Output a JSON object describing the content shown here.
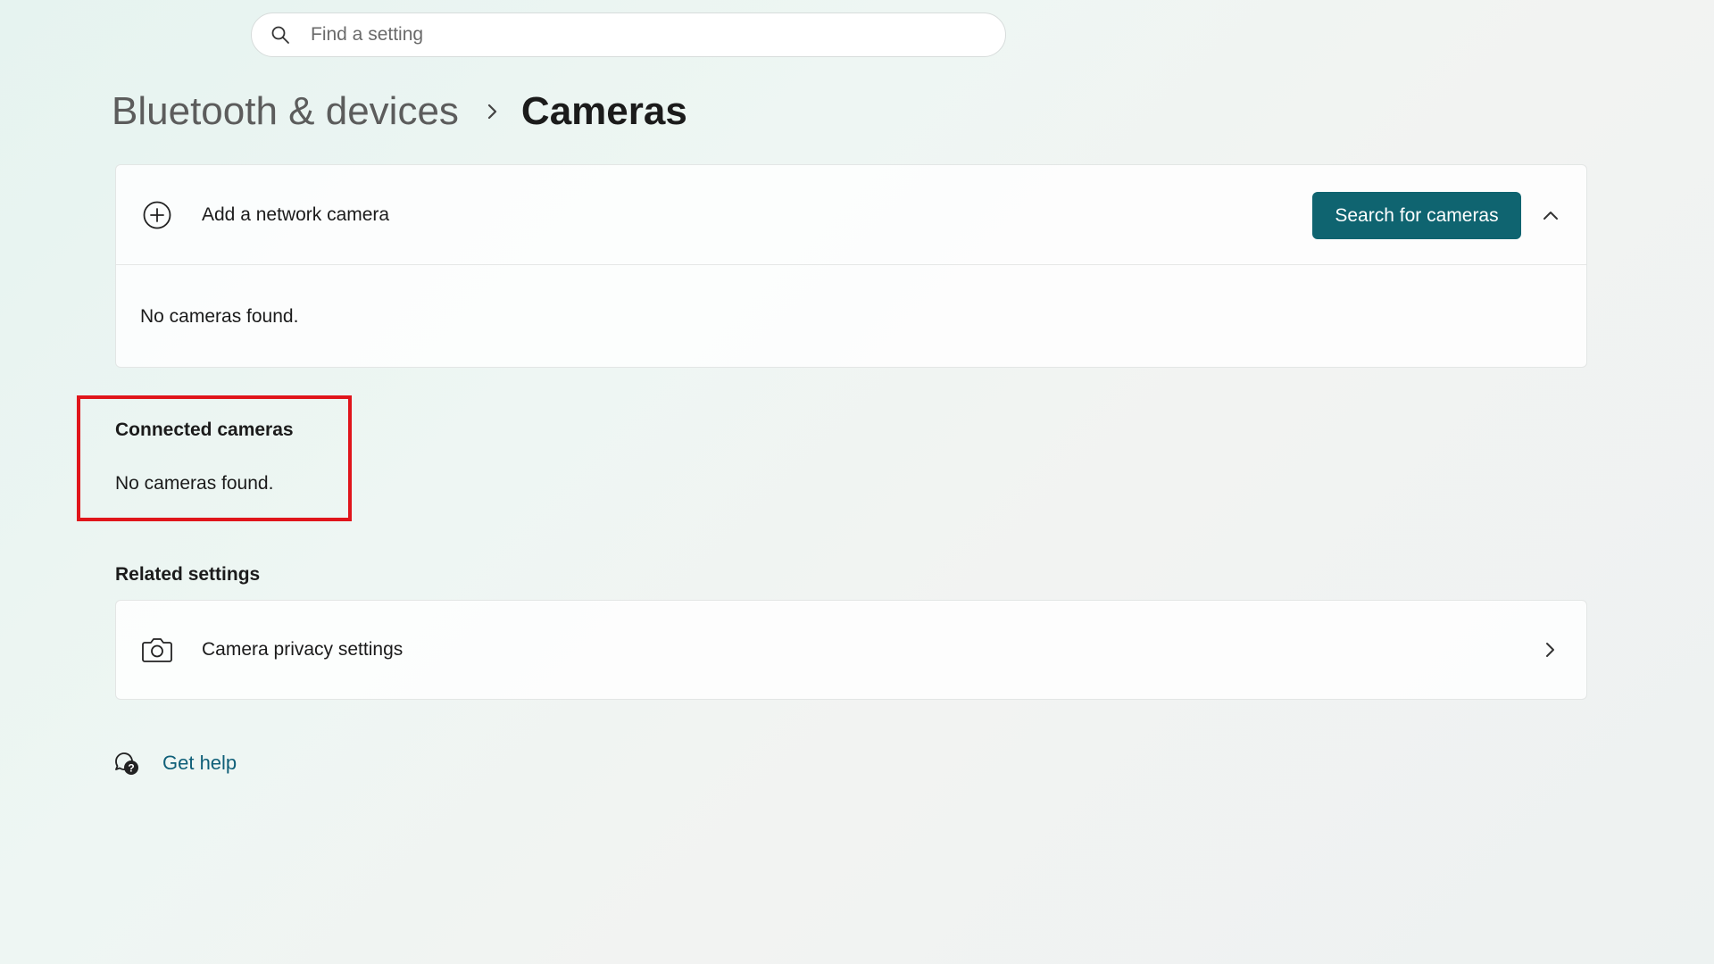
{
  "search": {
    "placeholder": "Find a setting",
    "icon": "search-icon"
  },
  "breadcrumb": {
    "parent": "Bluetooth & devices",
    "separator_icon": "chevron-right-icon",
    "current": "Cameras"
  },
  "network_camera": {
    "icon": "add-circle-icon",
    "label": "Add a network camera",
    "button_label": "Search for cameras",
    "expand_icon": "chevron-up-icon",
    "expanded": true,
    "message": "No cameras found."
  },
  "connected_cameras": {
    "title": "Connected cameras",
    "message": "No cameras found.",
    "highlight_color": "#e0151b"
  },
  "related_settings": {
    "title": "Related settings",
    "items": [
      {
        "icon": "camera-icon",
        "label": "Camera privacy settings",
        "trailing_icon": "chevron-right-icon"
      }
    ]
  },
  "help": {
    "icon": "help-chat-icon",
    "label": "Get help"
  },
  "colors": {
    "accent": "#0f6470",
    "link": "#0f5f78"
  }
}
